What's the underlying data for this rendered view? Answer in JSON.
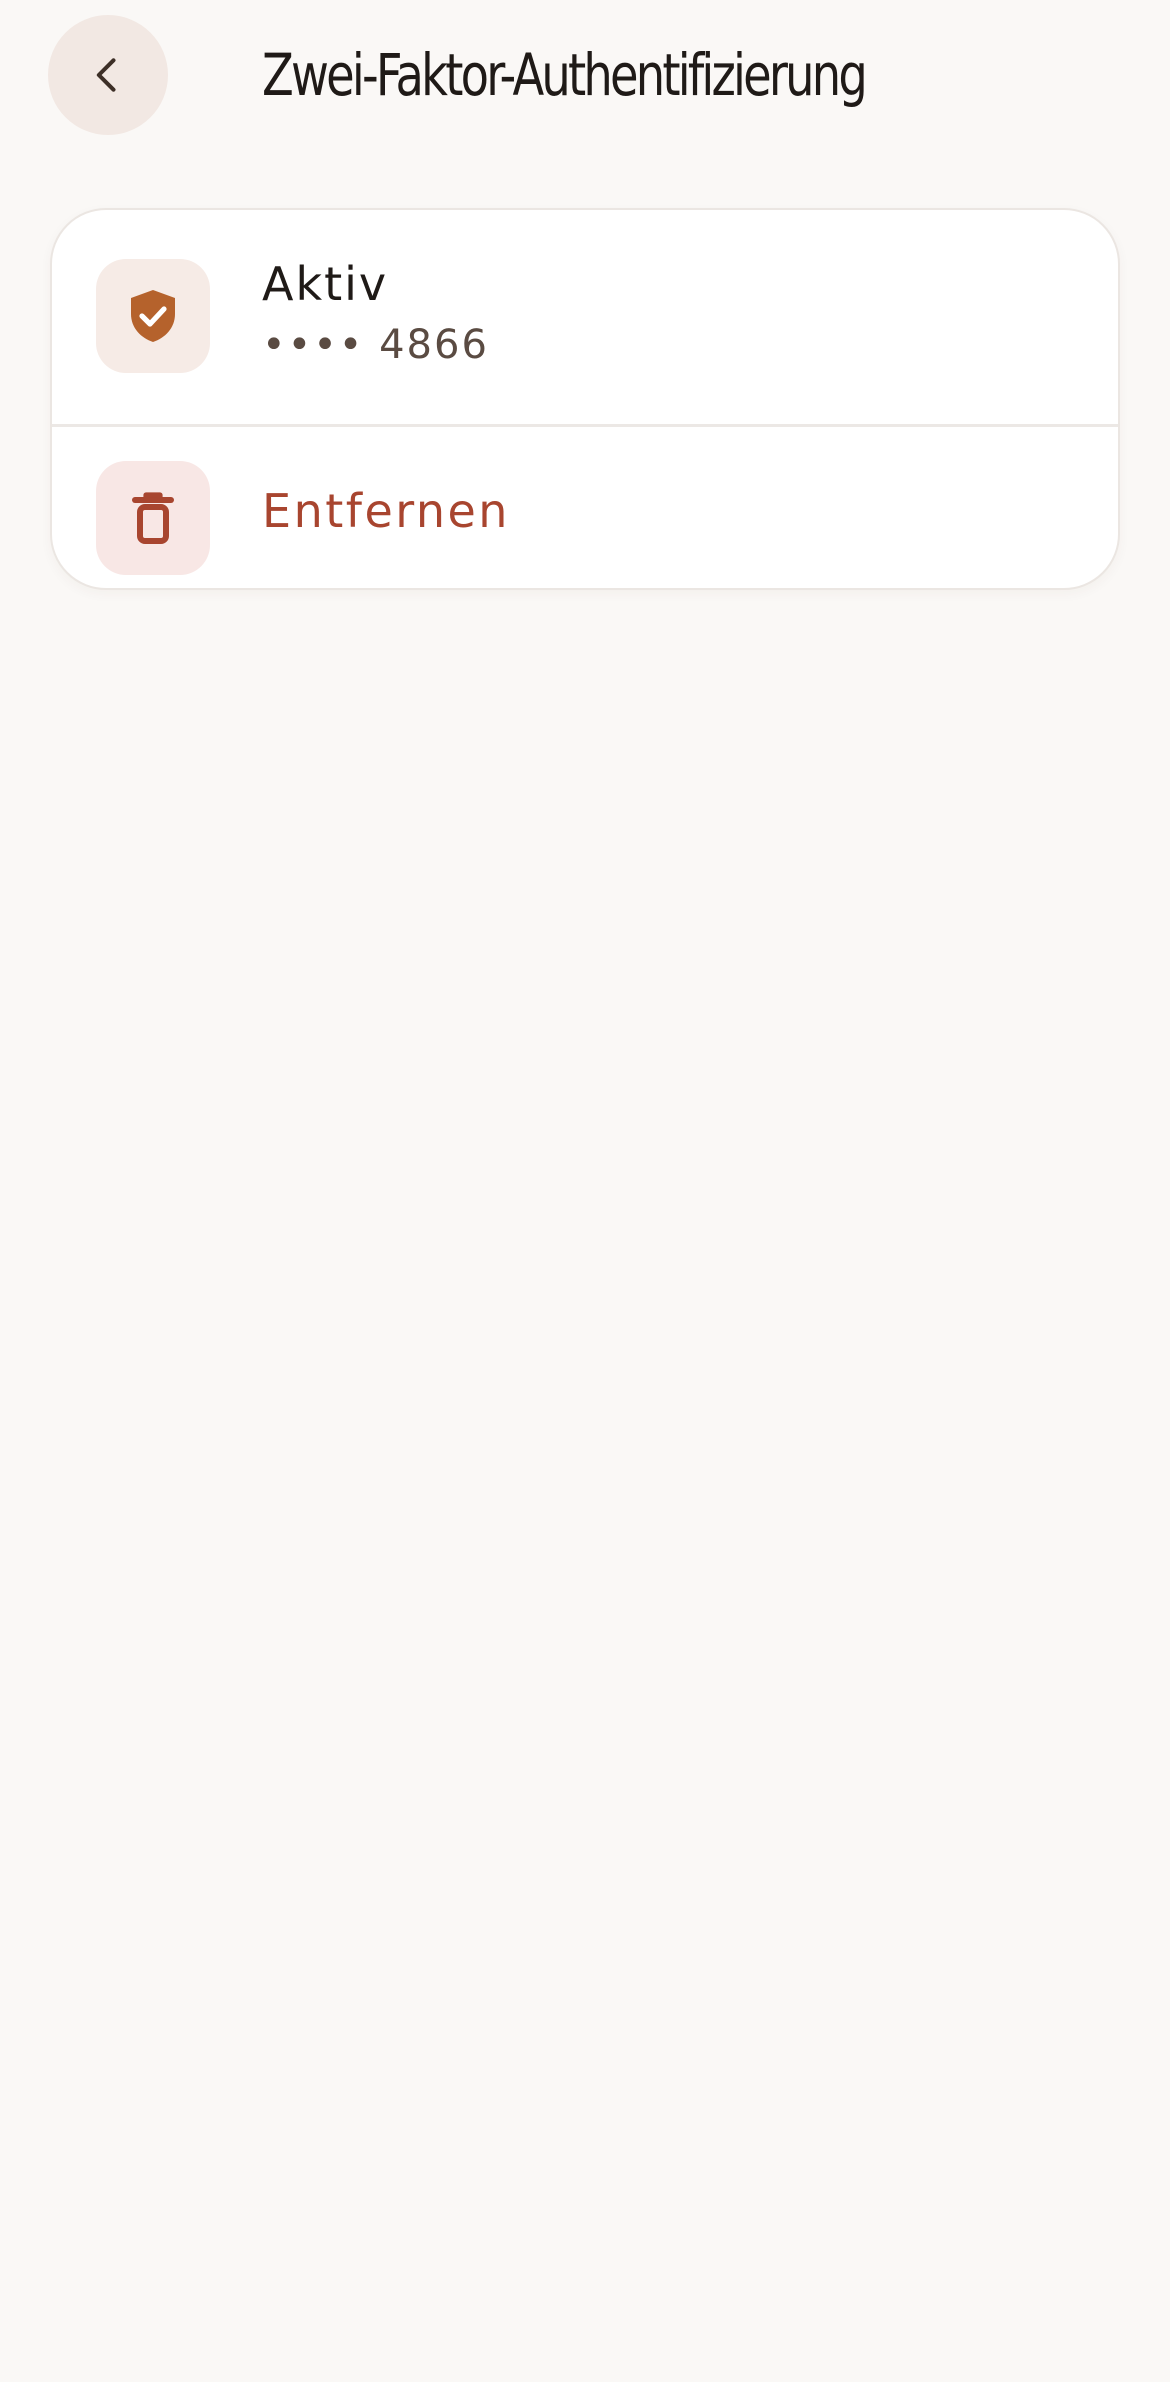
{
  "header": {
    "title": "Zwei-Faktor-Authentifizierung",
    "back_icon": "chevron-left-icon"
  },
  "status_row": {
    "icon": "shield-check-icon",
    "label": "Aktiv",
    "detail": "•••• 4866"
  },
  "remove_row": {
    "icon": "trash-icon",
    "label": "Entfernen"
  },
  "colors": {
    "background": "#faf8f6",
    "accent": "#b5622c",
    "danger": "#a8452f",
    "text": "#1f1a17"
  }
}
